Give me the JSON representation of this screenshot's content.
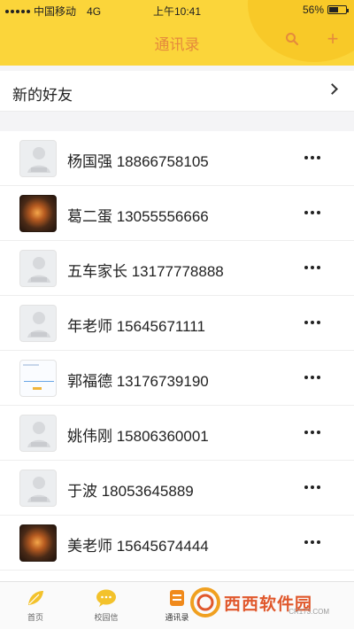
{
  "status_bar": {
    "carrier": "中国移动",
    "network": "4G",
    "time": "上午10:41",
    "battery_text": "56%",
    "battery_level": 0.56
  },
  "header": {
    "title": "通讯录",
    "search_icon": "search-icon",
    "add_icon": "plus-icon",
    "add_label": "+"
  },
  "new_friends": {
    "label": "新的好友"
  },
  "contacts": [
    {
      "name": "杨国强 18866758105",
      "avatar": "default-avatar"
    },
    {
      "name": "葛二蛋 13055556666",
      "avatar": "photo-avatar"
    },
    {
      "name": "五车家长 13177778888",
      "avatar": "default-avatar"
    },
    {
      "name": "年老师 15645671111",
      "avatar": "default-avatar"
    },
    {
      "name": "郭福德 13176739190",
      "avatar": "chart-avatar"
    },
    {
      "name": "姚伟刚 15806360001",
      "avatar": "default-avatar"
    },
    {
      "name": "于波 18053645889",
      "avatar": "default-avatar"
    },
    {
      "name": "美老师 15645674444",
      "avatar": "photo-avatar"
    }
  ],
  "tabbar": {
    "tabs": [
      {
        "label": "首页",
        "icon": "leaf-icon"
      },
      {
        "label": "校园信",
        "icon": "chat-bubble-icon"
      },
      {
        "label": "通讯录",
        "icon": "contacts-icon"
      }
    ]
  },
  "watermark": {
    "text": "西西软件园",
    "sub": "CR173.COM"
  },
  "colors": {
    "header_bg": "#fbd53a",
    "accent": "#e58a3c"
  }
}
